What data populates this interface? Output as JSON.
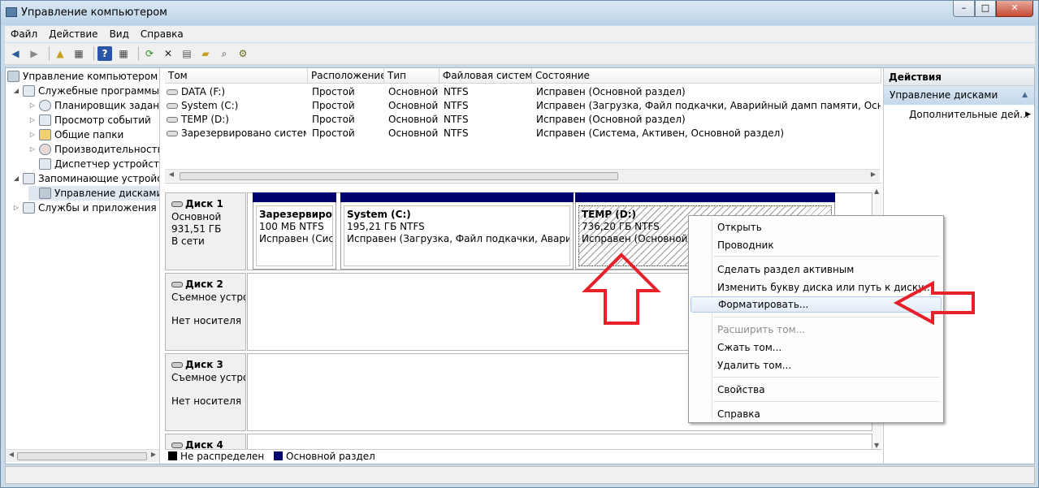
{
  "window": {
    "title": "Управление компьютером",
    "minimize": "–",
    "maximize": "□",
    "close": "✕"
  },
  "menu": [
    "Файл",
    "Действие",
    "Вид",
    "Справка"
  ],
  "tree": {
    "root": "Управление компьютером (л",
    "items": [
      {
        "label": "Служебные программы",
        "expander": "◢",
        "icon": "tools-icon"
      },
      {
        "label": "Планировщик заданий",
        "expander": "▷",
        "icon": "clock-icon"
      },
      {
        "label": "Просмотр событий",
        "expander": "▷",
        "icon": "event-viewer-icon"
      },
      {
        "label": "Общие папки",
        "expander": "▷",
        "icon": "shared-folder-icon"
      },
      {
        "label": "Производительность",
        "expander": "▷",
        "icon": "performance-icon"
      },
      {
        "label": "Диспетчер устройств",
        "expander": "",
        "icon": "device-manager-icon"
      },
      {
        "label": "Запоминающие устройст",
        "expander": "◢",
        "icon": "storage-icon"
      },
      {
        "label": "Управление дисками",
        "expander": "",
        "icon": "disk-management-icon"
      },
      {
        "label": "Службы и приложения",
        "expander": "▷",
        "icon": "services-icon"
      }
    ]
  },
  "volumes": {
    "headers": [
      "Том",
      "Расположение",
      "Тип",
      "Файловая система",
      "Состояние"
    ],
    "rows": [
      [
        "DATA (F:)",
        "Простой",
        "Основной",
        "NTFS",
        "Исправен (Основной раздел)"
      ],
      [
        "System (C:)",
        "Простой",
        "Основной",
        "NTFS",
        "Исправен (Загрузка, Файл подкачки, Аварийный дамп памяти, Основной ра"
      ],
      [
        "TEMP (D:)",
        "Простой",
        "Основной",
        "NTFS",
        "Исправен (Основной раздел)"
      ],
      [
        "Зарезервировано системой",
        "Простой",
        "Основной",
        "NTFS",
        "Исправен (Система, Активен, Основной раздел)"
      ]
    ]
  },
  "disks": [
    {
      "name": "Диск 1",
      "type": "Основной",
      "size": "931,51 ГБ",
      "status": "В сети"
    },
    {
      "name": "Диск 2",
      "type": "Съемное устро",
      "status": "Нет носителя"
    },
    {
      "name": "Диск 3",
      "type": "Съемное устро",
      "status": "Нет носителя"
    },
    {
      "name": "Диск 4"
    }
  ],
  "partitions": [
    {
      "name": "Зарезервирова",
      "size": "100 МБ NTFS",
      "status": "Исправен (Систе"
    },
    {
      "name": "System  (C:)",
      "size": "195,21 ГБ NTFS",
      "status": "Исправен (Загрузка, Файл подкачки, Аварийный"
    },
    {
      "name": "TEMP  (D:)",
      "size": "736,20 ГБ NTFS",
      "status": "Исправен (Основной разде"
    }
  ],
  "legend": {
    "unallocated": "Не распределен",
    "primary": "Основной раздел",
    "unallocated_color": "#000000",
    "primary_color": "#00006e"
  },
  "actions": {
    "header": "Действия",
    "section": "Управление дисками",
    "more": "Дополнительные дей..."
  },
  "context_menu": {
    "open": "Открыть",
    "explore": "Проводник",
    "mark_active": "Сделать раздел активным",
    "change_letter": "Изменить букву диска или путь к диску...",
    "format": "Форматировать...",
    "extend": "Расширить том...",
    "shrink": "Сжать том...",
    "delete": "Удалить том...",
    "properties": "Свойства",
    "help": "Справка"
  },
  "colors": {
    "arrow": "#e8202a",
    "partition_bar": "#00006e",
    "selection": "#dfe7f1"
  }
}
